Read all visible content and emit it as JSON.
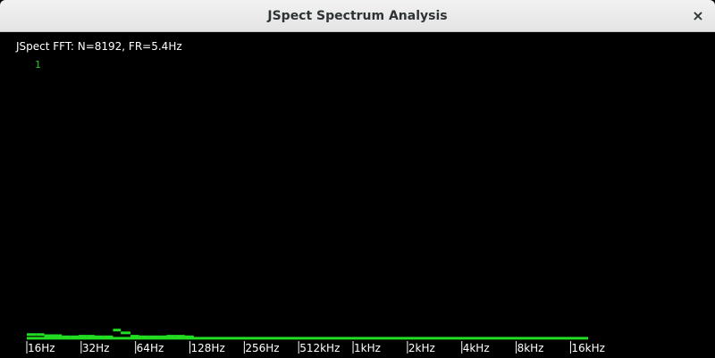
{
  "window": {
    "title": "JSpect Spectrum Analysis",
    "close_glyph": "×"
  },
  "spectrum": {
    "info": "JSpect FFT: N=8192, FR=5.4Hz",
    "scale_label": "1",
    "bar_color": "#22dd22",
    "axis_color": "#ffffff"
  },
  "chart_data": {
    "type": "bar",
    "xscale": "log2",
    "xlim": [
      16,
      20480
    ],
    "ylim": [
      0,
      1
    ],
    "tick_labels": [
      "16Hz",
      "32Hz",
      "64Hz",
      "128Hz",
      "256Hz",
      "512kHz",
      "1kHz",
      "2kHz",
      "4kHz",
      "8kHz",
      "16kHz"
    ],
    "tick_values": [
      16,
      32,
      64,
      128,
      256,
      512,
      1024,
      2048,
      4096,
      8192,
      16384
    ],
    "bars": [
      {
        "x": 16,
        "y": 0.012
      },
      {
        "x": 18,
        "y": 0.012
      },
      {
        "x": 20,
        "y": 0.008
      },
      {
        "x": 22.5,
        "y": 0.008
      },
      {
        "x": 25,
        "y": 0.004
      },
      {
        "x": 28,
        "y": 0.004
      },
      {
        "x": 31,
        "y": 0.006
      },
      {
        "x": 34,
        "y": 0.006
      },
      {
        "x": 38,
        "y": 0.004
      },
      {
        "x": 43,
        "y": 0.004
      },
      {
        "x": 48,
        "y": 0.028
      },
      {
        "x": 53,
        "y": 0.018
      },
      {
        "x": 60,
        "y": 0.006
      },
      {
        "x": 67,
        "y": 0.004
      },
      {
        "x": 76,
        "y": 0.004
      },
      {
        "x": 85,
        "y": 0.004
      },
      {
        "x": 95,
        "y": 0.006
      },
      {
        "x": 107,
        "y": 0.006
      },
      {
        "x": 120,
        "y": 0.004
      }
    ],
    "baseline": 0.002
  }
}
